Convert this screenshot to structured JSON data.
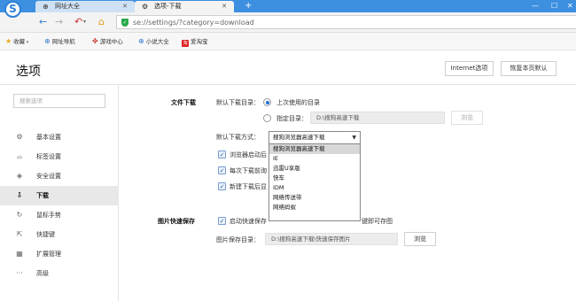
{
  "browser": {
    "logo_letter": "S",
    "tabs": [
      {
        "label": "网址大全",
        "active": false
      },
      {
        "label": "选项-下载",
        "active": true
      }
    ],
    "url": "se://settings/?category=download"
  },
  "bookmarks": [
    {
      "label": "收藏"
    },
    {
      "label": "网址导航"
    },
    {
      "label": "游戏中心"
    },
    {
      "label": "小说大全"
    },
    {
      "label": "爱淘宝",
      "badge": "淘"
    }
  ],
  "page": {
    "title": "选项",
    "internet_options_label": "Internet选项",
    "restore_defaults_label": "恢复本页默认"
  },
  "sidebar": {
    "search_placeholder": "搜索选项",
    "items": [
      {
        "label": "基本设置",
        "icon": "gear-icon"
      },
      {
        "label": "标签设置",
        "icon": "tab-icon"
      },
      {
        "label": "安全设置",
        "icon": "shield-icon"
      },
      {
        "label": "下载",
        "icon": "download-icon",
        "active": true
      },
      {
        "label": "鼠标手势",
        "icon": "mouse-gesture-icon"
      },
      {
        "label": "快捷键",
        "icon": "shortcut-icon"
      },
      {
        "label": "扩展管理",
        "icon": "extensions-icon"
      },
      {
        "label": "高级",
        "icon": "more-icon"
      }
    ]
  },
  "download": {
    "section_label": "文件下载",
    "default_dir_label": "默认下载目录：",
    "last_used_label": "上次使用的目录",
    "specify_dir_label": "指定目录：",
    "specify_dir_value": "D:\\搜狗高速下载",
    "browse_label": "浏览",
    "method_label": "默认下载方式：",
    "method_value": "搜狗浏览器高速下载",
    "method_options": [
      "搜狗浏览器高速下载",
      "IE",
      "迅雷U享版",
      "快车",
      "IDM",
      "网络传送带",
      "网络蚂蚁"
    ],
    "checkbox_1": "浏览器启动后",
    "checkbox_2": "每次下载前询",
    "checkbox_3": "新建下载后显"
  },
  "quicksave": {
    "section_label": "图片快速保存",
    "enable_label_start": "启动快速保存",
    "enable_label_end": "键即可存图",
    "dir_label": "图片保存目录：",
    "dir_value": "D:\\搜狗高速下载\\快速保存图片",
    "browse_label": "浏览"
  }
}
